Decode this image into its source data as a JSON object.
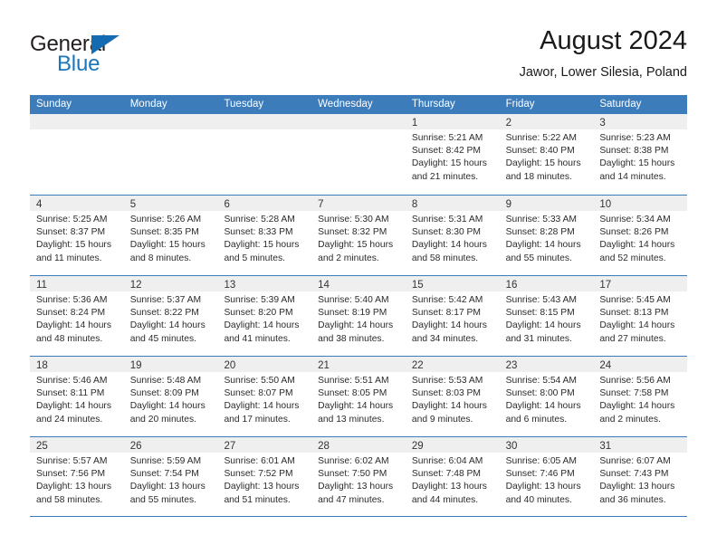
{
  "logo": {
    "word_top": "General",
    "word_bottom": "Blue",
    "triangle_color": "#156bb1",
    "blue_color": "#1b76bc"
  },
  "header": {
    "title": "August 2024",
    "location": "Jawor, Lower Silesia, Poland"
  },
  "theme": {
    "header_blue": "#3d7cbb",
    "daynum_band": "#efefef",
    "text": "#2b2b2b"
  },
  "calendar": {
    "weekdays": [
      "Sunday",
      "Monday",
      "Tuesday",
      "Wednesday",
      "Thursday",
      "Friday",
      "Saturday"
    ],
    "weeks": [
      [
        {
          "day": "",
          "sunrise": "",
          "sunset": "",
          "daylight1": "",
          "daylight2": "",
          "empty": true
        },
        {
          "day": "",
          "sunrise": "",
          "sunset": "",
          "daylight1": "",
          "daylight2": "",
          "empty": true
        },
        {
          "day": "",
          "sunrise": "",
          "sunset": "",
          "daylight1": "",
          "daylight2": "",
          "empty": true
        },
        {
          "day": "",
          "sunrise": "",
          "sunset": "",
          "daylight1": "",
          "daylight2": "",
          "empty": true
        },
        {
          "day": "1",
          "sunrise": "Sunrise: 5:21 AM",
          "sunset": "Sunset: 8:42 PM",
          "daylight1": "Daylight: 15 hours",
          "daylight2": "and 21 minutes."
        },
        {
          "day": "2",
          "sunrise": "Sunrise: 5:22 AM",
          "sunset": "Sunset: 8:40 PM",
          "daylight1": "Daylight: 15 hours",
          "daylight2": "and 18 minutes."
        },
        {
          "day": "3",
          "sunrise": "Sunrise: 5:23 AM",
          "sunset": "Sunset: 8:38 PM",
          "daylight1": "Daylight: 15 hours",
          "daylight2": "and 14 minutes."
        }
      ],
      [
        {
          "day": "4",
          "sunrise": "Sunrise: 5:25 AM",
          "sunset": "Sunset: 8:37 PM",
          "daylight1": "Daylight: 15 hours",
          "daylight2": "and 11 minutes."
        },
        {
          "day": "5",
          "sunrise": "Sunrise: 5:26 AM",
          "sunset": "Sunset: 8:35 PM",
          "daylight1": "Daylight: 15 hours",
          "daylight2": "and 8 minutes."
        },
        {
          "day": "6",
          "sunrise": "Sunrise: 5:28 AM",
          "sunset": "Sunset: 8:33 PM",
          "daylight1": "Daylight: 15 hours",
          "daylight2": "and 5 minutes."
        },
        {
          "day": "7",
          "sunrise": "Sunrise: 5:30 AM",
          "sunset": "Sunset: 8:32 PM",
          "daylight1": "Daylight: 15 hours",
          "daylight2": "and 2 minutes."
        },
        {
          "day": "8",
          "sunrise": "Sunrise: 5:31 AM",
          "sunset": "Sunset: 8:30 PM",
          "daylight1": "Daylight: 14 hours",
          "daylight2": "and 58 minutes."
        },
        {
          "day": "9",
          "sunrise": "Sunrise: 5:33 AM",
          "sunset": "Sunset: 8:28 PM",
          "daylight1": "Daylight: 14 hours",
          "daylight2": "and 55 minutes."
        },
        {
          "day": "10",
          "sunrise": "Sunrise: 5:34 AM",
          "sunset": "Sunset: 8:26 PM",
          "daylight1": "Daylight: 14 hours",
          "daylight2": "and 52 minutes."
        }
      ],
      [
        {
          "day": "11",
          "sunrise": "Sunrise: 5:36 AM",
          "sunset": "Sunset: 8:24 PM",
          "daylight1": "Daylight: 14 hours",
          "daylight2": "and 48 minutes."
        },
        {
          "day": "12",
          "sunrise": "Sunrise: 5:37 AM",
          "sunset": "Sunset: 8:22 PM",
          "daylight1": "Daylight: 14 hours",
          "daylight2": "and 45 minutes."
        },
        {
          "day": "13",
          "sunrise": "Sunrise: 5:39 AM",
          "sunset": "Sunset: 8:20 PM",
          "daylight1": "Daylight: 14 hours",
          "daylight2": "and 41 minutes."
        },
        {
          "day": "14",
          "sunrise": "Sunrise: 5:40 AM",
          "sunset": "Sunset: 8:19 PM",
          "daylight1": "Daylight: 14 hours",
          "daylight2": "and 38 minutes."
        },
        {
          "day": "15",
          "sunrise": "Sunrise: 5:42 AM",
          "sunset": "Sunset: 8:17 PM",
          "daylight1": "Daylight: 14 hours",
          "daylight2": "and 34 minutes."
        },
        {
          "day": "16",
          "sunrise": "Sunrise: 5:43 AM",
          "sunset": "Sunset: 8:15 PM",
          "daylight1": "Daylight: 14 hours",
          "daylight2": "and 31 minutes."
        },
        {
          "day": "17",
          "sunrise": "Sunrise: 5:45 AM",
          "sunset": "Sunset: 8:13 PM",
          "daylight1": "Daylight: 14 hours",
          "daylight2": "and 27 minutes."
        }
      ],
      [
        {
          "day": "18",
          "sunrise": "Sunrise: 5:46 AM",
          "sunset": "Sunset: 8:11 PM",
          "daylight1": "Daylight: 14 hours",
          "daylight2": "and 24 minutes."
        },
        {
          "day": "19",
          "sunrise": "Sunrise: 5:48 AM",
          "sunset": "Sunset: 8:09 PM",
          "daylight1": "Daylight: 14 hours",
          "daylight2": "and 20 minutes."
        },
        {
          "day": "20",
          "sunrise": "Sunrise: 5:50 AM",
          "sunset": "Sunset: 8:07 PM",
          "daylight1": "Daylight: 14 hours",
          "daylight2": "and 17 minutes."
        },
        {
          "day": "21",
          "sunrise": "Sunrise: 5:51 AM",
          "sunset": "Sunset: 8:05 PM",
          "daylight1": "Daylight: 14 hours",
          "daylight2": "and 13 minutes."
        },
        {
          "day": "22",
          "sunrise": "Sunrise: 5:53 AM",
          "sunset": "Sunset: 8:03 PM",
          "daylight1": "Daylight: 14 hours",
          "daylight2": "and 9 minutes."
        },
        {
          "day": "23",
          "sunrise": "Sunrise: 5:54 AM",
          "sunset": "Sunset: 8:00 PM",
          "daylight1": "Daylight: 14 hours",
          "daylight2": "and 6 minutes."
        },
        {
          "day": "24",
          "sunrise": "Sunrise: 5:56 AM",
          "sunset": "Sunset: 7:58 PM",
          "daylight1": "Daylight: 14 hours",
          "daylight2": "and 2 minutes."
        }
      ],
      [
        {
          "day": "25",
          "sunrise": "Sunrise: 5:57 AM",
          "sunset": "Sunset: 7:56 PM",
          "daylight1": "Daylight: 13 hours",
          "daylight2": "and 58 minutes."
        },
        {
          "day": "26",
          "sunrise": "Sunrise: 5:59 AM",
          "sunset": "Sunset: 7:54 PM",
          "daylight1": "Daylight: 13 hours",
          "daylight2": "and 55 minutes."
        },
        {
          "day": "27",
          "sunrise": "Sunrise: 6:01 AM",
          "sunset": "Sunset: 7:52 PM",
          "daylight1": "Daylight: 13 hours",
          "daylight2": "and 51 minutes."
        },
        {
          "day": "28",
          "sunrise": "Sunrise: 6:02 AM",
          "sunset": "Sunset: 7:50 PM",
          "daylight1": "Daylight: 13 hours",
          "daylight2": "and 47 minutes."
        },
        {
          "day": "29",
          "sunrise": "Sunrise: 6:04 AM",
          "sunset": "Sunset: 7:48 PM",
          "daylight1": "Daylight: 13 hours",
          "daylight2": "and 44 minutes."
        },
        {
          "day": "30",
          "sunrise": "Sunrise: 6:05 AM",
          "sunset": "Sunset: 7:46 PM",
          "daylight1": "Daylight: 13 hours",
          "daylight2": "and 40 minutes."
        },
        {
          "day": "31",
          "sunrise": "Sunrise: 6:07 AM",
          "sunset": "Sunset: 7:43 PM",
          "daylight1": "Daylight: 13 hours",
          "daylight2": "and 36 minutes."
        }
      ]
    ]
  }
}
